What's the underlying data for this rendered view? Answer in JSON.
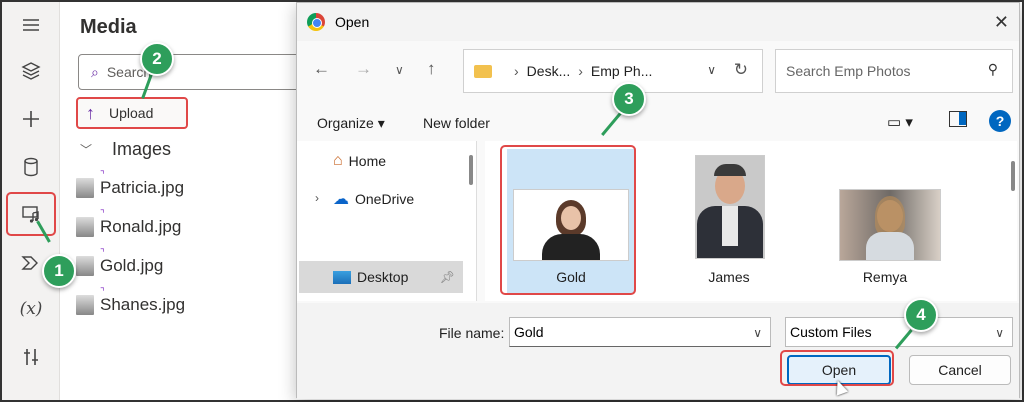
{
  "rail": {
    "icons": [
      "hamburger-icon",
      "layers-icon",
      "plus-icon",
      "database-icon",
      "media-icon",
      "power-automate-icon",
      "variables-icon",
      "tools-icon"
    ],
    "variables_label": "(x)"
  },
  "media": {
    "title": "Media",
    "search_placeholder": "Search",
    "upload_label": "Upload",
    "images_header": "Images",
    "files": [
      "Patricia.jpg",
      "Ronald.jpg",
      "Gold.jpg",
      "Shanes.jpg"
    ]
  },
  "dialog": {
    "title": "Open",
    "address": {
      "crumb1": "Desk...",
      "crumb2": "Emp Ph..."
    },
    "search_placeholder": "Search Emp Photos",
    "toolbar": {
      "organize": "Organize",
      "new_folder": "New folder"
    },
    "nav": [
      {
        "label": "Home"
      },
      {
        "label": "OneDrive"
      },
      {
        "label": "Desktop"
      }
    ],
    "tiles": [
      {
        "name": "Gold",
        "selected": true
      },
      {
        "name": "James",
        "selected": false
      },
      {
        "name": "Remya",
        "selected": false
      }
    ],
    "file_name_label": "File name:",
    "file_name_value": "Gold",
    "filter_value": "Custom Files",
    "open_label": "Open",
    "cancel_label": "Cancel"
  },
  "badges": [
    "1",
    "2",
    "3",
    "4"
  ],
  "colors": {
    "highlight": "#e04848",
    "badge": "#2e9e5b",
    "accent": "#0067c0",
    "selected_tile": "#cce4f7"
  }
}
